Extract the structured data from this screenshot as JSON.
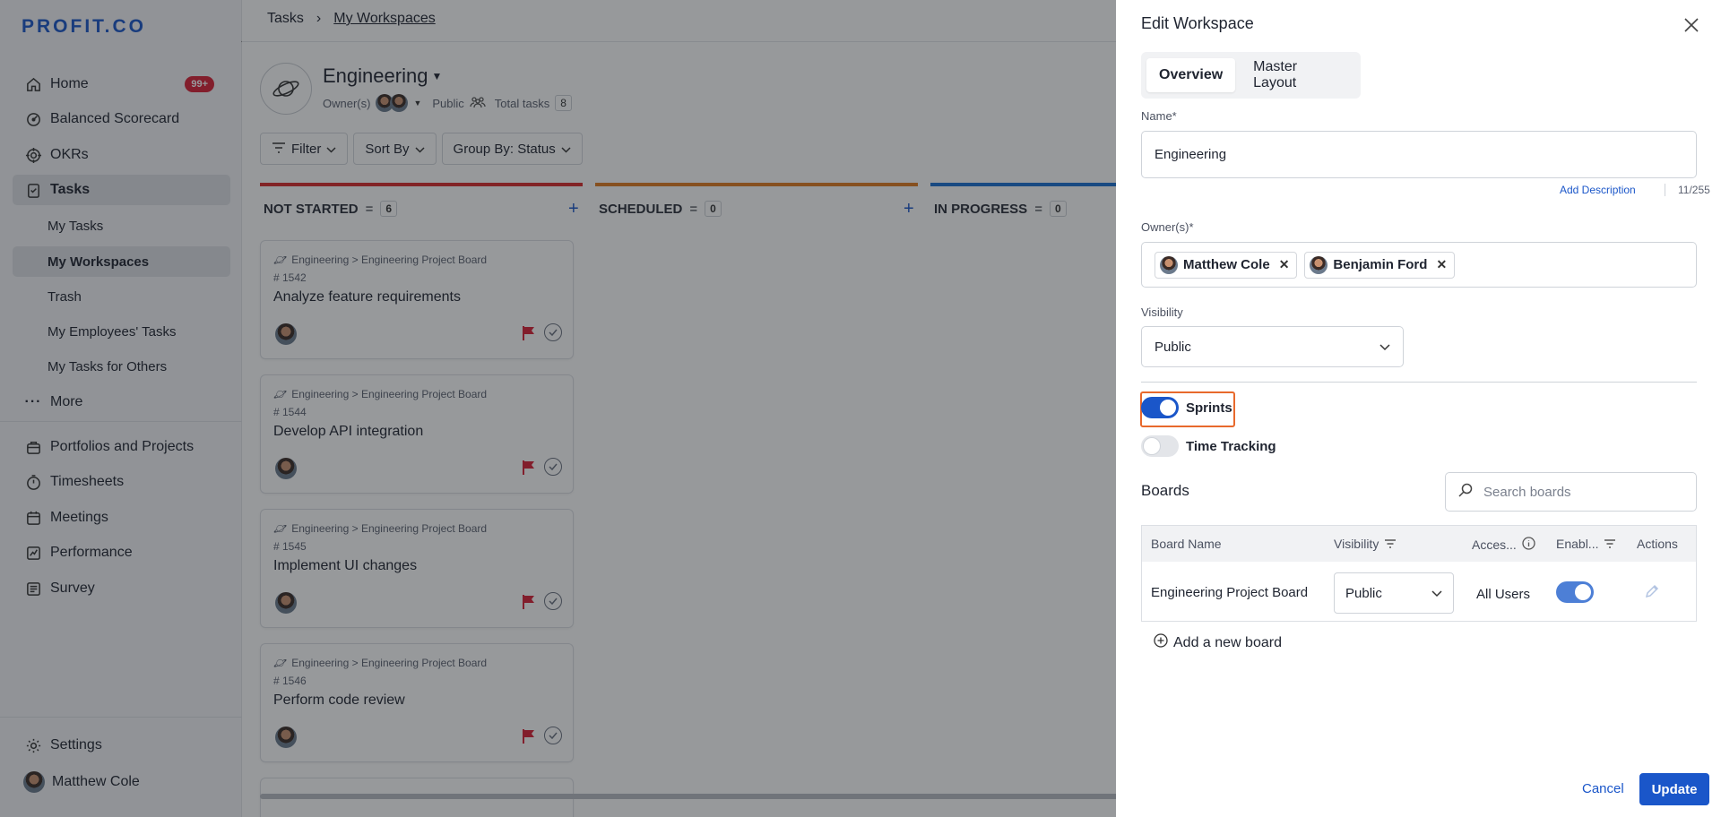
{
  "sidebar": {
    "logo": "PROFIT.CO",
    "home": {
      "label": "Home",
      "badge": "99+"
    },
    "items": [
      {
        "label": "Balanced Scorecard",
        "icon": "balanced-scorecard-icon"
      },
      {
        "label": "OKRs",
        "icon": "target-icon"
      },
      {
        "label": "Tasks",
        "icon": "tasks-icon"
      }
    ],
    "tasks_sub": [
      "My Tasks",
      "My Workspaces",
      "Trash",
      "My Employees' Tasks",
      "My Tasks for Others"
    ],
    "more": "More",
    "apps": [
      "Portfolios and Projects",
      "Timesheets",
      "Meetings",
      "Performance",
      "Survey"
    ],
    "settings": "Settings",
    "user": "Matthew Cole"
  },
  "breadcrumb": {
    "root": "Tasks",
    "sep": "›",
    "current": "My Workspaces"
  },
  "workspace": {
    "title": "Engineering",
    "owners_label": "Owner(s)",
    "visibility": "Public",
    "total_label": "Total tasks",
    "total": "8"
  },
  "toolbar": {
    "filter": "Filter",
    "sort": "Sort By",
    "group": "Group By: Status"
  },
  "columns": [
    {
      "name": "NOT STARTED",
      "count": "6",
      "color": "#d92b2b"
    },
    {
      "name": "SCHEDULED",
      "count": "0",
      "color": "#e07a1f"
    },
    {
      "name": "IN PROGRESS",
      "count": "0",
      "color": "#1a6fd1"
    }
  ],
  "cards": [
    {
      "path": "Engineering > Engineering Project Board",
      "num": "# 1542",
      "title": "Analyze feature requirements"
    },
    {
      "path": "Engineering > Engineering Project Board",
      "num": "# 1544",
      "title": "Develop API integration"
    },
    {
      "path": "Engineering > Engineering Project Board",
      "num": "# 1545",
      "title": "Implement UI changes"
    },
    {
      "path": "Engineering > Engineering Project Board",
      "num": "# 1546",
      "title": "Perform code review"
    }
  ],
  "drawer": {
    "title": "Edit Workspace",
    "tabs": [
      "Overview",
      "Master Layout"
    ],
    "name_label": "Name*",
    "name_value": "Engineering",
    "add_description": "Add Description",
    "char_count": "11/255",
    "owners_label": "Owner(s)*",
    "owners": [
      "Matthew Cole",
      "Benjamin Ford"
    ],
    "visibility_label": "Visibility",
    "visibility_value": "Public",
    "sprints_label": "Sprints",
    "sprints_on": true,
    "time_tracking_label": "Time Tracking",
    "time_tracking_on": false,
    "boards_title": "Boards",
    "search_placeholder": "Search boards",
    "table": {
      "headers": [
        "Board Name",
        "Visibility",
        "Acces...",
        "Enabl...",
        "Actions"
      ],
      "rows": [
        {
          "name": "Engineering Project Board",
          "visibility": "Public",
          "access": "All Users",
          "enabled": true
        }
      ]
    },
    "add_board": "Add a new board",
    "cancel": "Cancel",
    "update": "Update"
  },
  "colors": {
    "accent": "#1a56c9",
    "highlight": "#e8692c",
    "badge": "#d91f36",
    "flag": "#d91f36"
  }
}
